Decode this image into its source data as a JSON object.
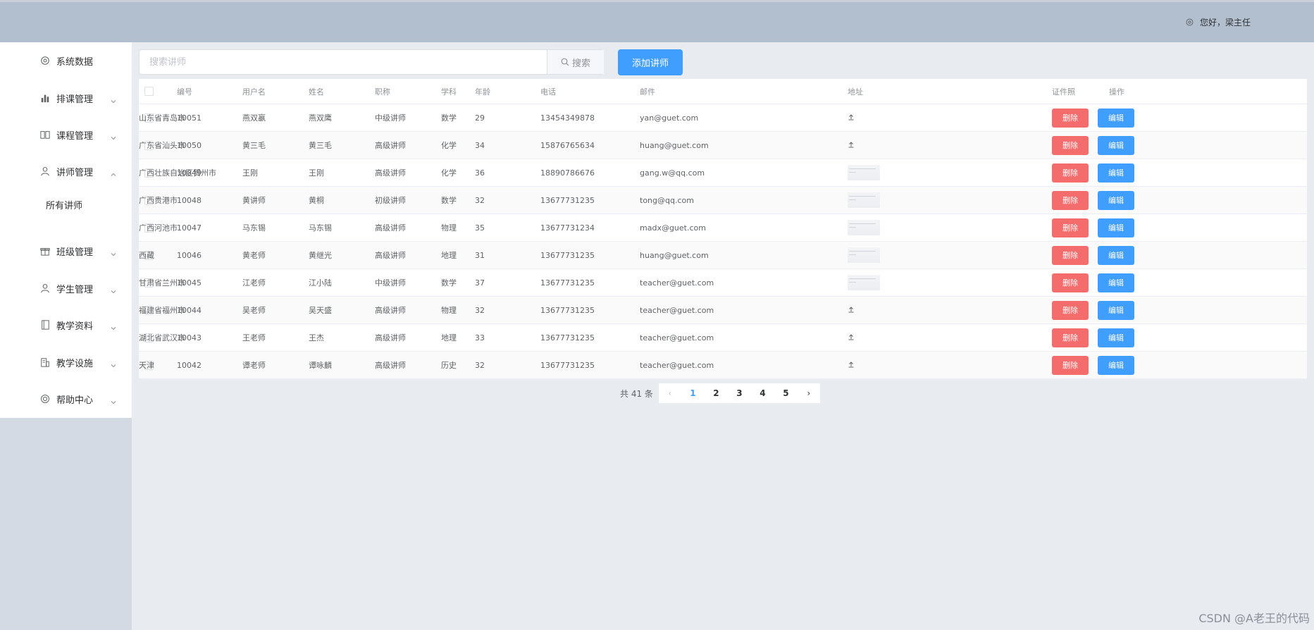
{
  "header": {
    "greeting": "您好，梁主任"
  },
  "sidebar": {
    "items": [
      {
        "label": "系统数据",
        "icon": "gear-icon",
        "expandable": false
      },
      {
        "label": "排课管理",
        "icon": "bar-chart-icon",
        "expandable": true
      },
      {
        "label": "课程管理",
        "icon": "book-icon",
        "expandable": true
      },
      {
        "label": "讲师管理",
        "icon": "user-icon",
        "expandable": true,
        "expanded": true
      },
      {
        "label": "班级管理",
        "icon": "gift-box-icon",
        "expandable": true
      },
      {
        "label": "学生管理",
        "icon": "user-icon",
        "expandable": true
      },
      {
        "label": "教学资料",
        "icon": "notebook-icon",
        "expandable": true
      },
      {
        "label": "教学设施",
        "icon": "building-icon",
        "expandable": true
      },
      {
        "label": "帮助中心",
        "icon": "help-circle-icon",
        "expandable": true
      }
    ],
    "submenu": {
      "label": "所有讲师"
    }
  },
  "toolbar": {
    "search_placeholder": "搜索讲师",
    "search_label": "搜索",
    "add_label": "添加讲师"
  },
  "table": {
    "headers": [
      "编号",
      "用户名",
      "姓名",
      "职称",
      "学科",
      "年龄",
      "电话",
      "邮件",
      "地址",
      "证件照",
      "操作"
    ],
    "rows": [
      {
        "id": "10051",
        "username": "燕双嬴",
        "name": "燕双鹰",
        "title": "中级讲师",
        "subject": "数学",
        "age": "29",
        "phone": "13454349878",
        "email": "yan@guet.com",
        "address": "山东省青岛市",
        "photo": "upload"
      },
      {
        "id": "10050",
        "username": "黄三毛",
        "name": "黄三毛",
        "title": "高级讲师",
        "subject": "化学",
        "age": "34",
        "phone": "15876765634",
        "email": "huang@guet.com",
        "address": "广东省汕头市",
        "photo": "upload"
      },
      {
        "id": "10049",
        "username": "王刚",
        "name": "王刚",
        "title": "高级讲师",
        "subject": "化学",
        "age": "36",
        "phone": "18890786676",
        "email": "gang.w@qq.com",
        "address": "广西壮族自治区贺州市",
        "photo": "thumb"
      },
      {
        "id": "10048",
        "username": "黄讲师",
        "name": "黄桐",
        "title": "初级讲师",
        "subject": "数学",
        "age": "32",
        "phone": "13677731235",
        "email": "tong@qq.com",
        "address": "广西贵港市",
        "photo": "thumb"
      },
      {
        "id": "10047",
        "username": "马东锡",
        "name": "马东锡",
        "title": "高级讲师",
        "subject": "物理",
        "age": "35",
        "phone": "13677731234",
        "email": "madx@guet.com",
        "address": "广西河池市",
        "photo": "thumb"
      },
      {
        "id": "10046",
        "username": "黄老师",
        "name": "黄继光",
        "title": "高级讲师",
        "subject": "地理",
        "age": "31",
        "phone": "13677731235",
        "email": "huang@guet.com",
        "address": "西藏",
        "photo": "thumb"
      },
      {
        "id": "10045",
        "username": "江老师",
        "name": "江小陆",
        "title": "中级讲师",
        "subject": "数学",
        "age": "37",
        "phone": "13677731235",
        "email": "teacher@guet.com",
        "address": "甘肃省兰州市",
        "photo": "thumb"
      },
      {
        "id": "10044",
        "username": "吴老师",
        "name": "吴天盛",
        "title": "高级讲师",
        "subject": "物理",
        "age": "32",
        "phone": "13677731235",
        "email": "teacher@guet.com",
        "address": "福建省福州市",
        "photo": "upload"
      },
      {
        "id": "10043",
        "username": "王老师",
        "name": "王杰",
        "title": "高级讲师",
        "subject": "地理",
        "age": "33",
        "phone": "13677731235",
        "email": "teacher@guet.com",
        "address": "湖北省武汉市",
        "photo": "upload"
      },
      {
        "id": "10042",
        "username": "谭老师",
        "name": "谭咏麟",
        "title": "高级讲师",
        "subject": "历史",
        "age": "32",
        "phone": "13677731235",
        "email": "teacher@guet.com",
        "address": "天津",
        "photo": "upload"
      }
    ],
    "delete_label": "删除",
    "edit_label": "编辑"
  },
  "pagination": {
    "total_label": "共 41 条",
    "pages": [
      "1",
      "2",
      "3",
      "4",
      "5"
    ],
    "current": "1"
  },
  "watermark": "CSDN @A老王的代码",
  "colors": {
    "primary": "#409eff",
    "danger": "#f56c6c",
    "header_bg": "#b2bfcf"
  }
}
